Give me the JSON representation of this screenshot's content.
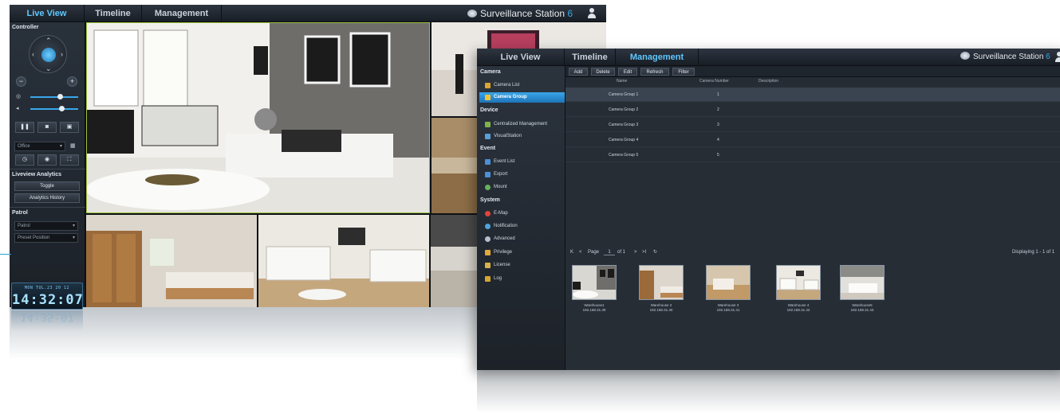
{
  "back": {
    "tabs": [
      "Live View",
      "Timeline",
      "Management"
    ],
    "brand": "Surveillance Station",
    "brand_version": "6",
    "sidebar": {
      "controller_title": "Controller",
      "ptz_icons": [
        "up-arrow",
        "down-arrow",
        "left-arrow",
        "right-arrow",
        "home"
      ],
      "zoom_out": "−",
      "zoom_in": "+",
      "layout_value": "Office",
      "analytics_title": "Liveview Analytics",
      "toggle": "Toggle",
      "analytics_history": "Analytics History",
      "patrol_title": "Patrol",
      "patrol_select": "Patrol",
      "preset_select": "Preset Position"
    },
    "clock": {
      "date": "MON TUL.23 20 12",
      "time": "14:32:07",
      "reflection": "14:35:07"
    }
  },
  "front": {
    "tabs": [
      "Live View",
      "Timeline",
      "Management"
    ],
    "brand": "Surveillance Station",
    "brand_version": "6",
    "sidebar": {
      "sections": [
        {
          "title": "Camera",
          "items": [
            {
              "label": "Camera List",
              "icon": "camera-list-icon"
            },
            {
              "label": "Camera Group",
              "icon": "camera-group-icon",
              "active": true
            }
          ]
        },
        {
          "title": "Device",
          "items": [
            {
              "label": "Centralized Management",
              "icon": "cms-icon"
            },
            {
              "label": "VisualStation",
              "icon": "visualstation-icon"
            }
          ]
        },
        {
          "title": "Event",
          "items": [
            {
              "label": "Event List",
              "icon": "event-list-icon"
            },
            {
              "label": "Export",
              "icon": "export-icon"
            },
            {
              "label": "Mount",
              "icon": "mount-icon"
            }
          ]
        },
        {
          "title": "System",
          "items": [
            {
              "label": "E-Map",
              "icon": "emap-icon"
            },
            {
              "label": "Notification",
              "icon": "notification-icon"
            },
            {
              "label": "Advanced",
              "icon": "advanced-icon"
            },
            {
              "label": "Privilege",
              "icon": "privilege-icon"
            },
            {
              "label": "License",
              "icon": "license-icon"
            },
            {
              "label": "Log",
              "icon": "log-icon"
            }
          ]
        }
      ]
    },
    "toolbar": [
      "Add",
      "Delete",
      "Edit",
      "Refresh",
      "Filter"
    ],
    "table": {
      "headers": [
        "Name",
        "Camera Number",
        "Description"
      ],
      "rows": [
        [
          "Camera Group 1",
          "1",
          ""
        ],
        [
          "Camera Group 2",
          "2",
          ""
        ],
        [
          "Camera Group 3",
          "3",
          ""
        ],
        [
          "Camera Group 4",
          "4",
          ""
        ],
        [
          "Camera Group 5",
          "5",
          ""
        ]
      ]
    },
    "pager": {
      "page_label": "Page",
      "page_value": "1",
      "of_label": "of 1",
      "displaying": "Displaying 1 - 1 of 1"
    },
    "thumbnails": [
      {
        "name": "Warehouse1",
        "ip": "192.168.31.39"
      },
      {
        "name": "Warehouse 2",
        "ip": "192.168.31.40"
      },
      {
        "name": "Warehouse 3",
        "ip": "192.168.31.41"
      },
      {
        "name": "Warehouse 4",
        "ip": "192.168.31.42"
      },
      {
        "name": "Warehouse5",
        "ip": "192.168.31.43"
      }
    ]
  }
}
